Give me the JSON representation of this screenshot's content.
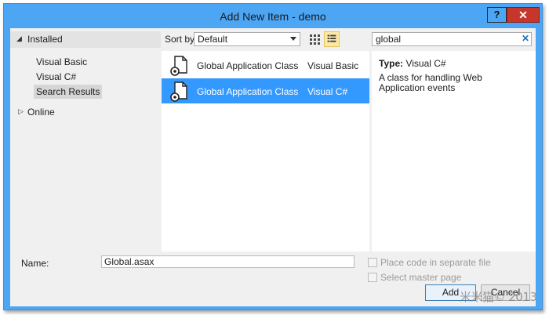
{
  "window": {
    "title": "Add New Item - demo",
    "help_label": "?",
    "close_label": "✕"
  },
  "left": {
    "installed_label": "Installed",
    "items": [
      {
        "label": "Visual Basic"
      },
      {
        "label": "Visual C#"
      },
      {
        "label": "Search Results"
      }
    ],
    "online_label": "Online"
  },
  "sortbar": {
    "label": "Sort by:",
    "selected": "Default"
  },
  "search": {
    "value": "global",
    "clear": "✕"
  },
  "templates": [
    {
      "name": "Global Application Class",
      "language": "Visual Basic",
      "selected": false
    },
    {
      "name": "Global Application Class",
      "language": "Visual C#",
      "selected": true
    }
  ],
  "details": {
    "type_label": "Type:",
    "type_value": "Visual C#",
    "description": "A class for handling Web Application events"
  },
  "footer": {
    "name_label": "Name:",
    "name_value": "Global.asax",
    "place_code_label": "Place code in separate file",
    "select_master_label": "Select master page",
    "add_label": "Add",
    "cancel_label": "Cancel"
  },
  "watermark": "米米猫© 2013",
  "colors": {
    "titlebar": "#4da6f4",
    "close": "#c7352b",
    "selection": "#3399ff"
  }
}
